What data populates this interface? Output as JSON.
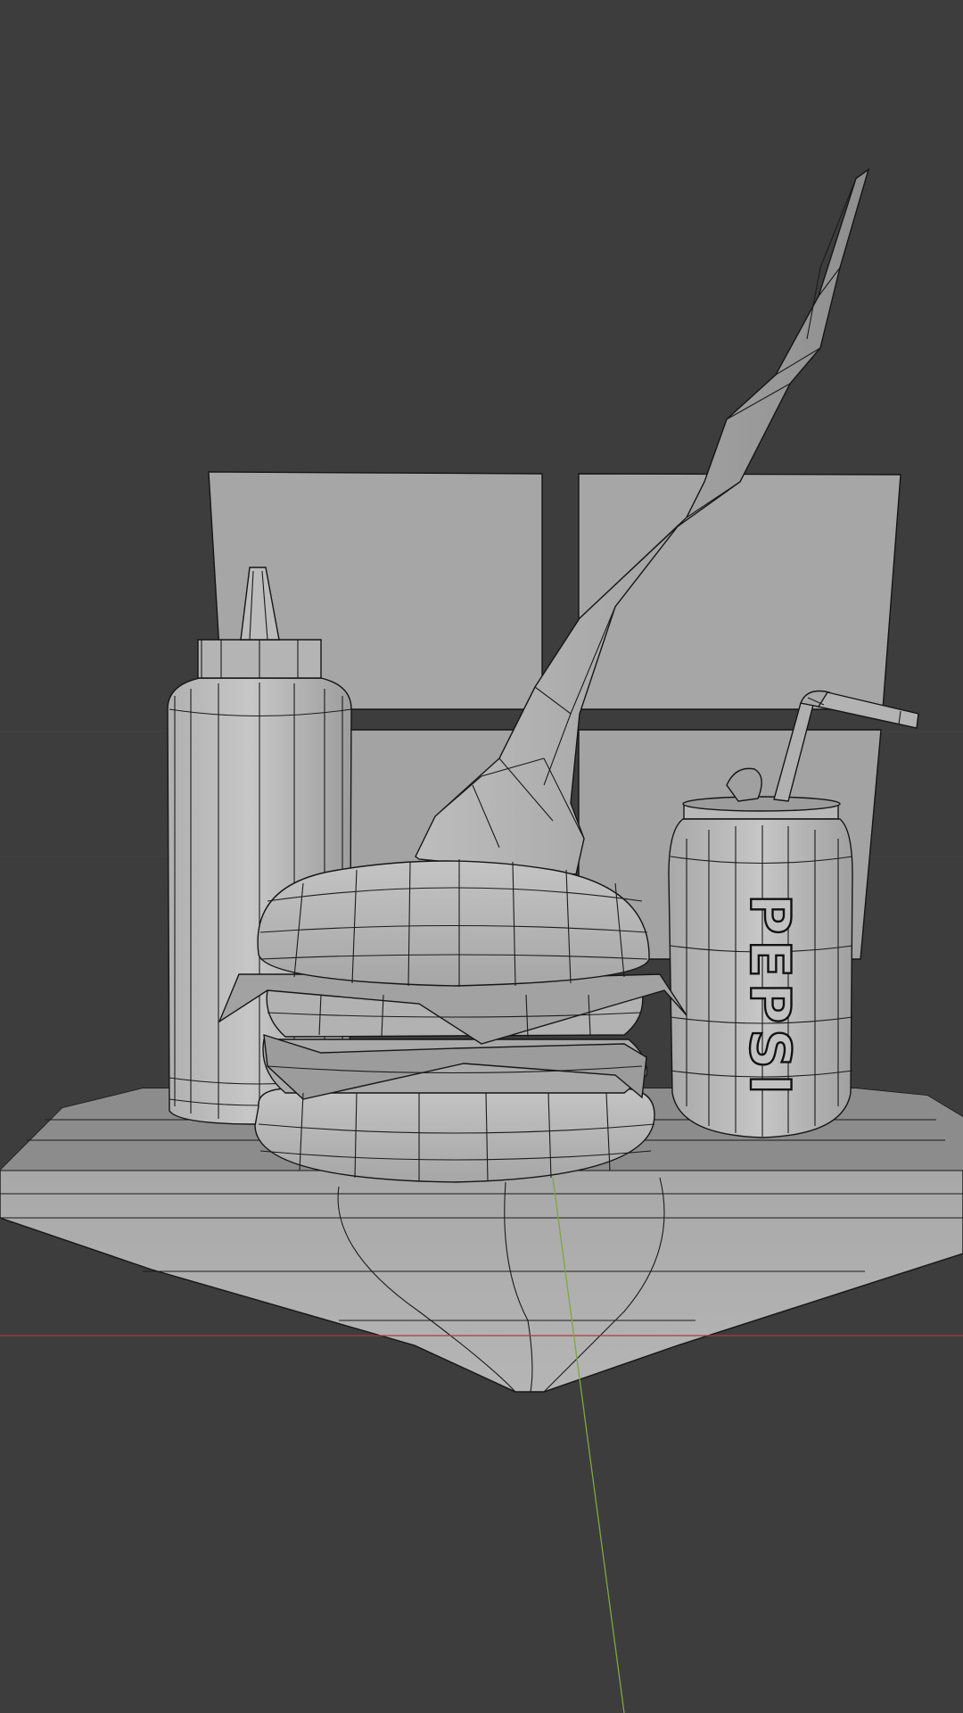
{
  "viewport": {
    "background": "#3d3d3d",
    "axis_x_color": "#b03a3a",
    "axis_y_color": "#7ea83a"
  },
  "scene": {
    "objects": [
      "table",
      "window",
      "ketchup-bottle",
      "burger",
      "soda-can",
      "straw",
      "fries-stick"
    ],
    "can_label": "PEPSI"
  }
}
